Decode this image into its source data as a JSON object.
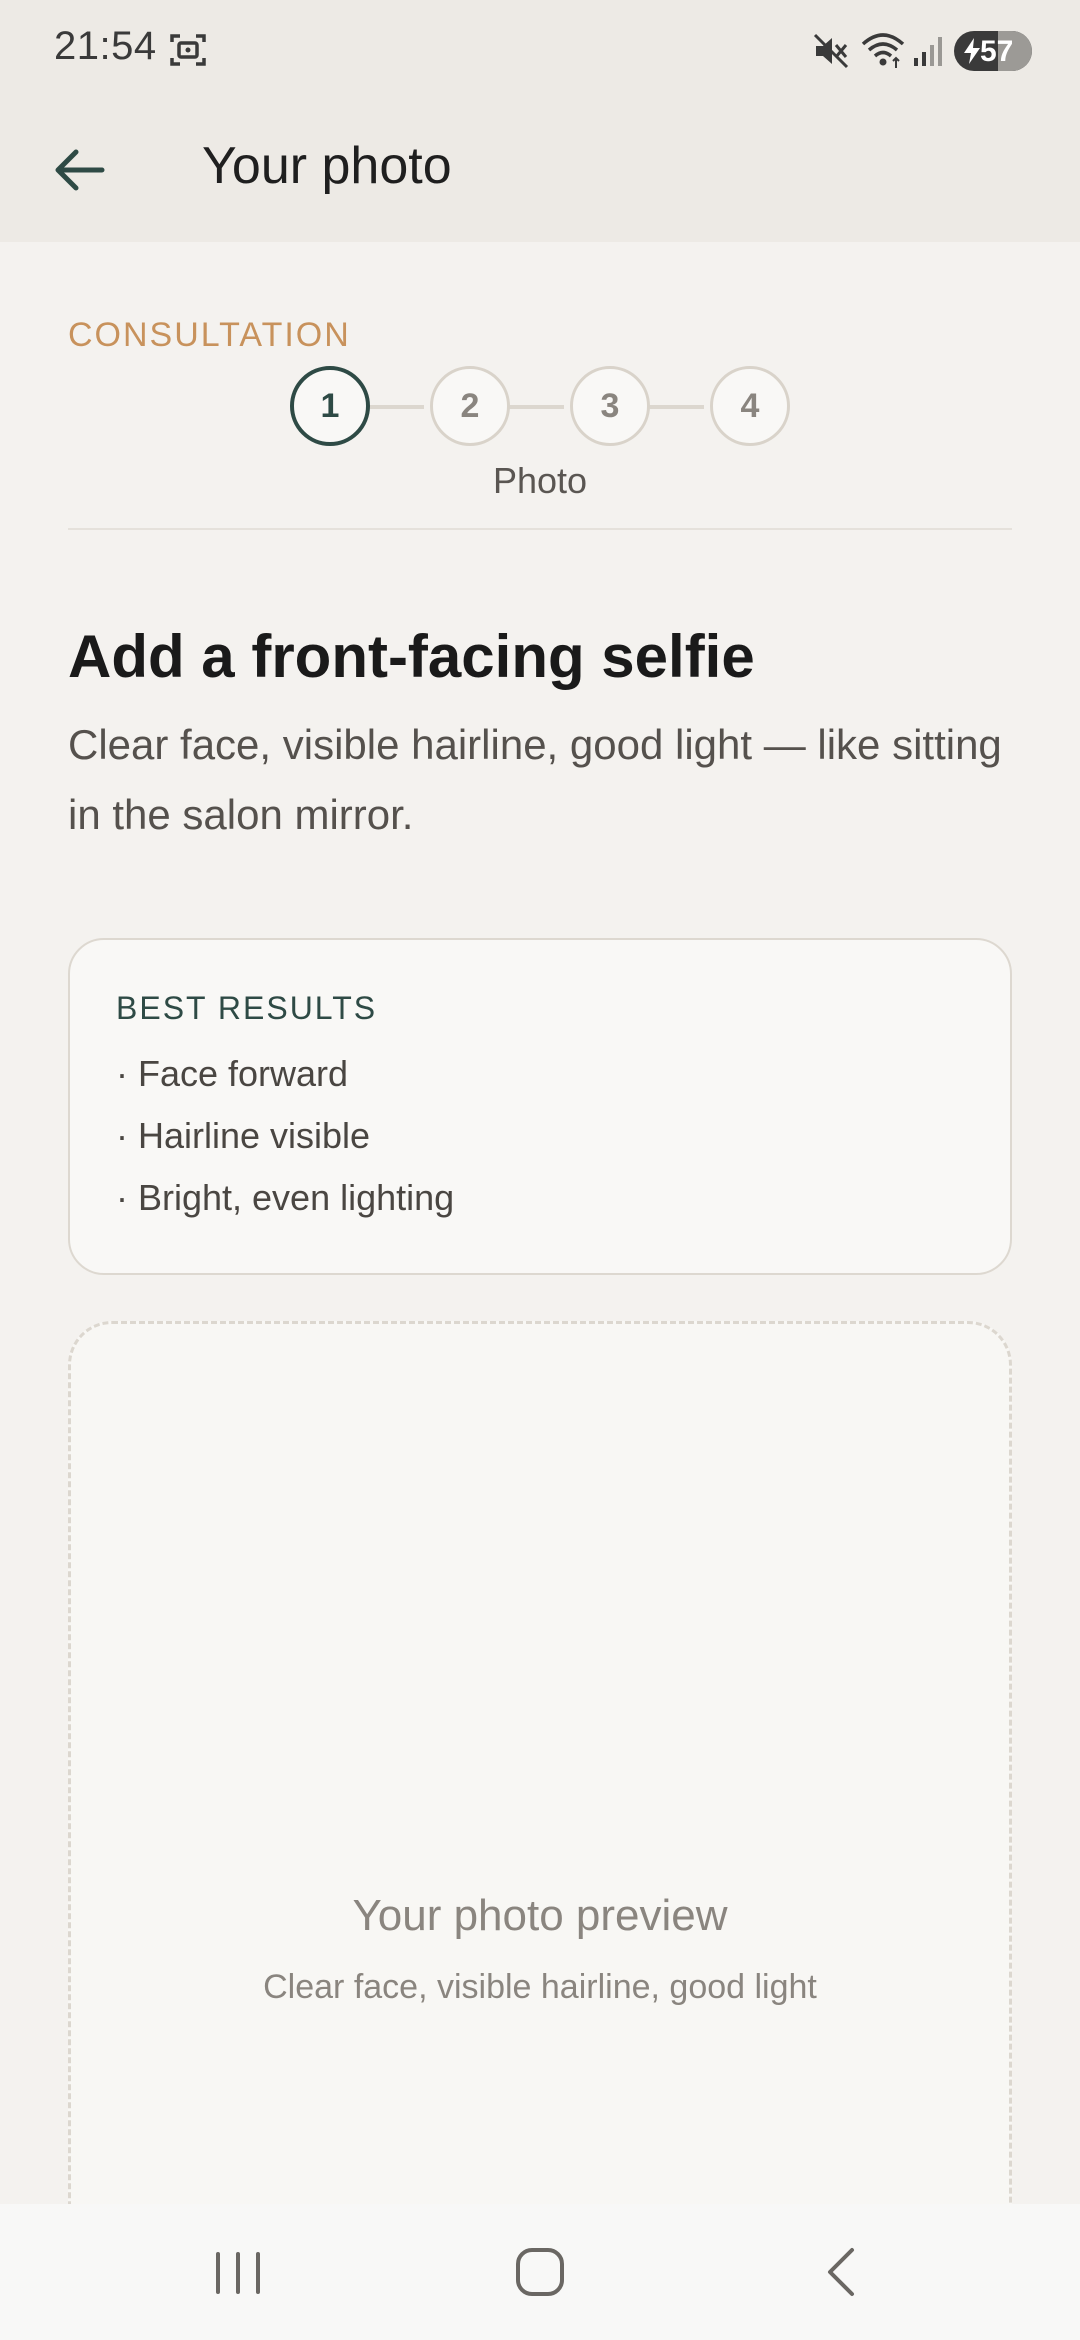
{
  "status_bar": {
    "time": "21:54",
    "battery_percent": "57",
    "icons": [
      "screenshot-icon",
      "mute-icon",
      "wifi-icon",
      "signal-icon",
      "battery-charging-icon"
    ]
  },
  "app_bar": {
    "back_icon": "arrow-left-icon",
    "title": "Your photo"
  },
  "consultation": {
    "label": "CONSULTATION",
    "steps": [
      "1",
      "2",
      "3",
      "4"
    ],
    "active_step": 1,
    "current_step_caption": "Photo"
  },
  "intro": {
    "headline": "Add a front-facing selfie",
    "subtext": "Clear face, visible hairline, good light — like sitting in the salon mirror."
  },
  "tips": {
    "title": "BEST RESULTS",
    "items": [
      "· Face forward",
      "· Hairline visible",
      "· Bright, even lighting"
    ]
  },
  "preview": {
    "title": "Your photo preview",
    "subtitle": "Clear face, visible hairline, good light"
  },
  "nav_bar": {
    "icons": [
      "recents-icon",
      "home-icon",
      "back-icon"
    ]
  },
  "colors": {
    "accent_dark": "#2e4a45",
    "accent_warm": "#c8925c",
    "background": "#f4f2ef",
    "header_background": "#edeae5"
  }
}
